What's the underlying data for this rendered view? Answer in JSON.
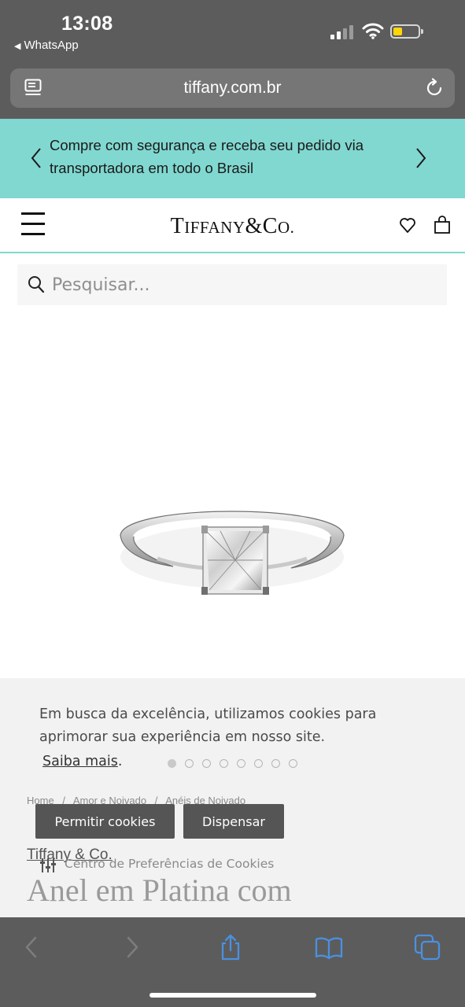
{
  "status_bar": {
    "time": "13:08",
    "back_app": "WhatsApp",
    "battery_color": "#ffd60a"
  },
  "browser": {
    "url": "tiffany.com.br",
    "icons": [
      "reader-mode-icon",
      "reload-icon"
    ]
  },
  "promo": {
    "text": "Compre com segurança e receba seu pedido via transportadora em todo o Brasil",
    "background": "#81d8d0"
  },
  "header": {
    "logo_main": "TIFFANY",
    "logo_amp": "&",
    "logo_co": "CO.",
    "icons": [
      "menu-icon",
      "wishlist-heart-icon",
      "shopping-bag-icon"
    ]
  },
  "search": {
    "placeholder": "Pesquisar..."
  },
  "product": {
    "image": "diamond-solitaire-ring",
    "brand": "Tiffany & Co.",
    "title": "Anel em Platina com"
  },
  "breadcrumb": [
    "Home",
    "/",
    "Amor e Noivado",
    "/",
    "Anéis de Noivado"
  ],
  "cookie_banner": {
    "text": "Em busca da excelência, utilizamos cookies para aprimorar sua experiência em nosso site.",
    "learn_more": "Saiba mais",
    "learn_more_suffix": ".",
    "allow_button": "Permitir cookies",
    "dismiss_button": "Dispensar",
    "preferences_link": "Centro de Preferências de Cookies",
    "carousel_total": 8,
    "carousel_active": 1
  },
  "toolbar": {
    "icons": [
      "back-arrow-icon",
      "forward-arrow-icon",
      "share-icon",
      "bookmarks-icon",
      "tabs-icon"
    ],
    "active_color": "#4a90e2"
  }
}
